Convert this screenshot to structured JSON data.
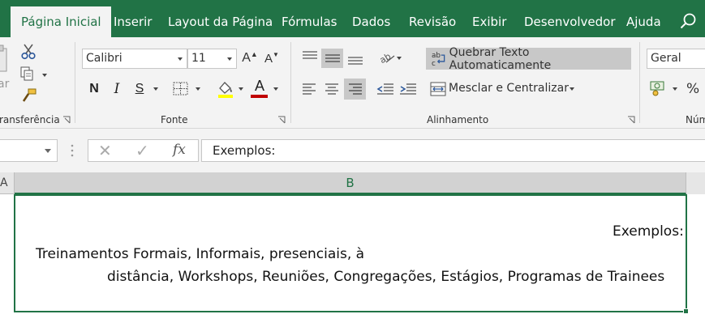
{
  "ribbon_tabs": {
    "home": "Página Inicial",
    "insert": "Inserir",
    "page_layout": "Layout da Página",
    "formulas": "Fórmulas",
    "data": "Dados",
    "review": "Revisão",
    "view": "Exibir",
    "developer": "Desenvolvedor",
    "help": "Ajuda",
    "search_icon": "search-icon"
  },
  "clipboard": {
    "label": "ransferência",
    "paste_partial": "ar",
    "icons": [
      "paste-icon",
      "cut-icon",
      "copy-icon",
      "format-painter-icon"
    ]
  },
  "font": {
    "label": "Fonte",
    "font_name": "Calibri",
    "font_size": "11",
    "bold": "N",
    "italic": "I",
    "underline": "S",
    "increase_size": "A",
    "decrease_size": "A",
    "font_color_letter": "A",
    "fill_color": "#ffff00",
    "text_color": "#c00000"
  },
  "alignment": {
    "label": "Alinhamento",
    "wrap_text": "Quebrar Texto Automaticamente",
    "merge_center": "Mesclar e Centralizar",
    "wrap_icon_text": "ab"
  },
  "number": {
    "label": "Núm",
    "format": "Geral",
    "percent": "%"
  },
  "formula_bar": {
    "cancel": "✕",
    "enter": "✓",
    "fx": "fx",
    "content": "Exemplos:"
  },
  "grid": {
    "col_a": "A",
    "col_b": "B",
    "cell_line1": "Exemplos:",
    "cell_line2": "Treinamentos Formais, Informais, presenciais, à",
    "cell_line3": "distância, Workshops, Reuniões, Congregações, Estágios, Programas de Trainees"
  },
  "colors": {
    "excel_green": "#217346",
    "ribbon_bg": "#f3f3f3",
    "selected_button": "#c8c8c8"
  }
}
